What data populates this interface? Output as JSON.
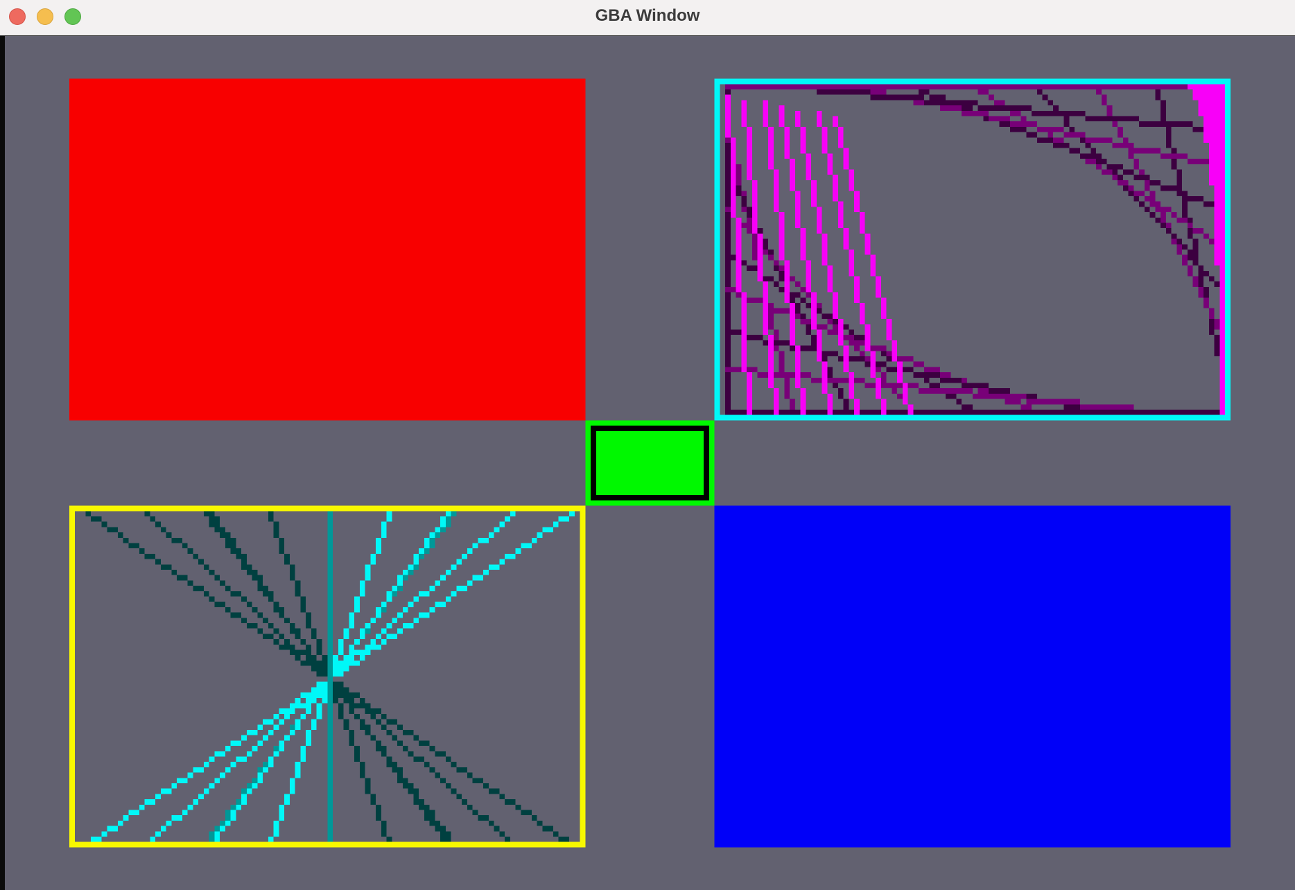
{
  "window": {
    "title": "GBA Window",
    "background_color": "#626170",
    "controls": [
      "close-button",
      "minimize-button",
      "maximize-button"
    ]
  },
  "scene": {
    "resolution": [
      240,
      160
    ],
    "panels": [
      {
        "name": "red-filled-rectangle",
        "fill": "#f80000"
      },
      {
        "name": "cyan-outlined-rectangle",
        "outline": "#00f8f8",
        "line_colors": [
          "#f800f8",
          "#780078",
          "#3c0040"
        ]
      },
      {
        "name": "green-center-rectangle",
        "fill": "#00f800",
        "outline": "#000000"
      },
      {
        "name": "yellow-outlined-rectangle",
        "outline": "#f8f800",
        "line_colors": [
          "#00f8f8",
          "#009898",
          "#004040"
        ]
      },
      {
        "name": "blue-filled-rectangle",
        "fill": "#0000f8"
      }
    ]
  }
}
